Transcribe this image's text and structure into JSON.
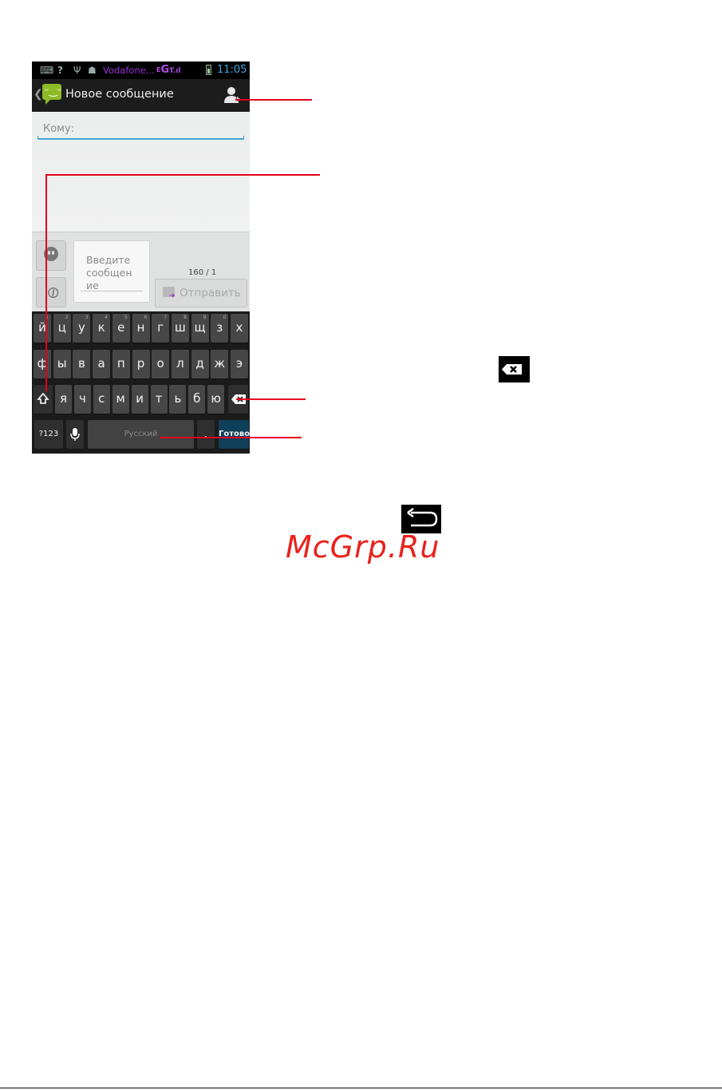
{
  "statusbar": {
    "carrier": "Vodafone...",
    "network": "G",
    "time": "11:05",
    "icons": [
      "keyboard-icon",
      "wifi-question-icon",
      "usb-icon",
      "android-debug-icon",
      "notification-icon",
      "signal-icon",
      "battery-icon"
    ]
  },
  "actionbar": {
    "title": "Новое сообщение",
    "icons": [
      "back-chevron-icon",
      "messaging-app-icon",
      "add-contact-icon"
    ]
  },
  "recipient": {
    "placeholder": "Кому:"
  },
  "compose": {
    "placeholder": "Введите сообщение",
    "placeholder_lines": [
      "Введите",
      "сообщен",
      "ие"
    ],
    "counter": "160 / 1",
    "send_label": "Отправить"
  },
  "keyboard": {
    "row1": [
      "й",
      "ц",
      "у",
      "к",
      "е",
      "н",
      "г",
      "ш",
      "щ",
      "з",
      "х"
    ],
    "row1_hints": [
      "1",
      "2",
      "3",
      "4",
      "5",
      "6",
      "7",
      "8",
      "9",
      "0",
      ""
    ],
    "row2": [
      "ф",
      "ы",
      "в",
      "а",
      "п",
      "р",
      "о",
      "л",
      "д",
      "ж",
      "э"
    ],
    "row3": [
      "я",
      "ч",
      "с",
      "м",
      "и",
      "т",
      "ь",
      "б",
      "ю"
    ],
    "symbols_label": "?123",
    "space_label": "Русский",
    "period_label": ".",
    "done_label": "Готово"
  },
  "watermark": "McGrp.Ru",
  "colors": {
    "callout": "#e3001b",
    "accent_blue": "#3fa7d6",
    "carrier_purple": "#9b30d9",
    "clock_blue": "#39a7e0",
    "app_green": "#8dbb26",
    "watermark_red": "#e8221c"
  }
}
